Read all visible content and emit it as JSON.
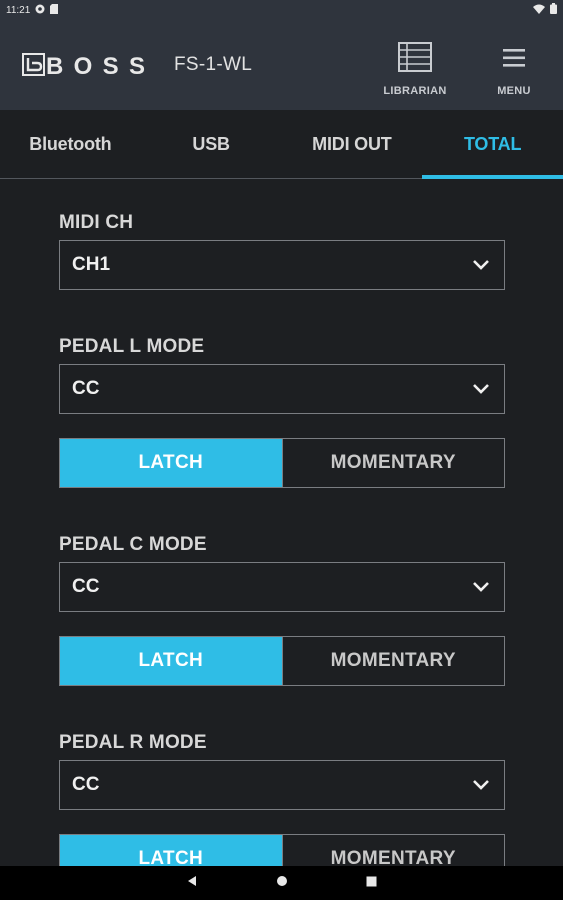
{
  "status": {
    "time": "11:21"
  },
  "header": {
    "brand": "BOSS",
    "device": "FS-1-WL",
    "librarian_label": "LIBRARIAN",
    "menu_label": "MENU"
  },
  "tabs": [
    {
      "label": "Bluetooth",
      "active": false
    },
    {
      "label": "USB",
      "active": false
    },
    {
      "label": "MIDI OUT",
      "active": false
    },
    {
      "label": "TOTAL",
      "active": true
    }
  ],
  "settings": {
    "midi_ch": {
      "label": "MIDI CH",
      "value": "CH1"
    },
    "pedal_l": {
      "label": "PEDAL L MODE",
      "value": "CC",
      "latch": "LATCH",
      "momentary": "MOMENTARY",
      "selected": "LATCH"
    },
    "pedal_c": {
      "label": "PEDAL C MODE",
      "value": "CC",
      "latch": "LATCH",
      "momentary": "MOMENTARY",
      "selected": "LATCH"
    },
    "pedal_r": {
      "label": "PEDAL R MODE",
      "value": "CC",
      "latch": "LATCH",
      "momentary": "MOMENTARY",
      "selected": "LATCH"
    }
  },
  "colors": {
    "accent": "#2fbde6",
    "header_bg": "#2f343d",
    "body_bg": "#1d1f22"
  },
  "icons": [
    "settings-gear-icon",
    "sd-card-icon",
    "wifi-icon",
    "battery-icon",
    "librarian-list-icon",
    "menu-hamburger-icon",
    "chevron-down-icon",
    "back-triangle-icon",
    "home-circle-icon",
    "recents-square-icon"
  ]
}
